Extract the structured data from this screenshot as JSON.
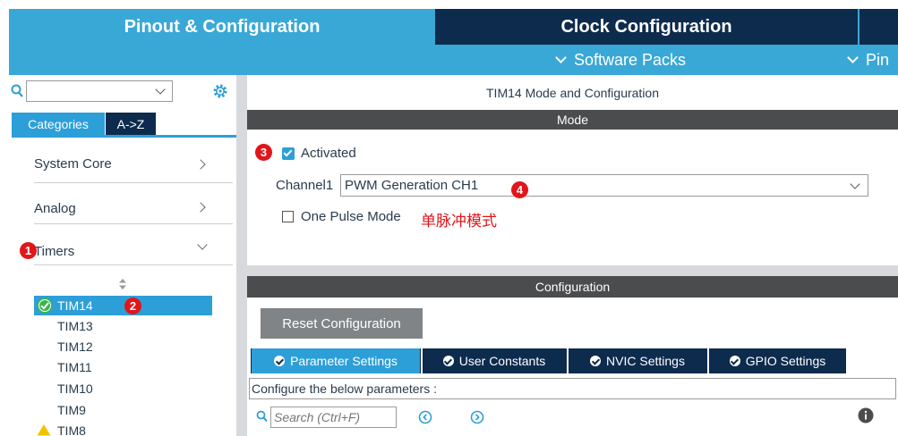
{
  "top_tabs": {
    "pinout": "Pinout & Configuration",
    "clock": "Clock Configuration",
    "software_packs": "Software Packs",
    "pinout_view": "Pin"
  },
  "left": {
    "tab_categories": "Categories",
    "tab_az": "A->Z",
    "categories": [
      "System Core",
      "Analog",
      "Timers"
    ],
    "timers": [
      "TIM14",
      "TIM13",
      "TIM12",
      "TIM11",
      "TIM10",
      "TIM9",
      "TIM8"
    ],
    "badges": [
      "1",
      "2"
    ]
  },
  "right": {
    "panel_title": "TIM14 Mode and Configuration",
    "mode_header": "Mode",
    "activated_label": "Activated",
    "channel_label": "Channel1",
    "channel_value": "PWM Generation CH1",
    "one_pulse_label": "One Pulse Mode",
    "annotation_cn": "单脉冲模式",
    "badges": [
      "3",
      "4"
    ],
    "config_header": "Configuration",
    "reset_button": "Reset Configuration",
    "tabs": [
      "Parameter Settings",
      "User Constants",
      "NVIC Settings",
      "GPIO Settings"
    ],
    "configure_text": "Configure the below parameters :",
    "search_placeholder": "Search (Ctrl+F)"
  },
  "colors": {
    "accent_blue": "#3aa8d6",
    "navy": "#0d2b4d",
    "badge_red": "#e0161b",
    "selected_blue": "#2d9fd8"
  }
}
